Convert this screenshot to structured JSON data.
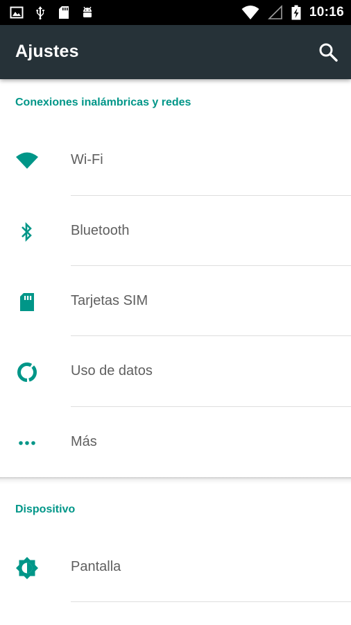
{
  "status_bar": {
    "time": "10:16",
    "left_icons": [
      "image-icon",
      "usb-icon",
      "sd-card-icon",
      "android-icon"
    ],
    "right_icons": [
      "wifi-signal-icon",
      "cell-signal-icon",
      "battery-icon"
    ]
  },
  "app_bar": {
    "title": "Ajustes",
    "action_icon": "search-icon"
  },
  "sections": [
    {
      "header": "Conexiones inalámbricas y redes",
      "items": [
        {
          "label": "Wi-Fi",
          "icon": "wifi-icon"
        },
        {
          "label": "Bluetooth",
          "icon": "bluetooth-icon"
        },
        {
          "label": "Tarjetas SIM",
          "icon": "sim-card-icon"
        },
        {
          "label": "Uso de datos",
          "icon": "data-usage-icon"
        },
        {
          "label": "Más",
          "icon": "more-dots-icon"
        }
      ]
    },
    {
      "header": "Dispositivo",
      "items": [
        {
          "label": "Pantalla",
          "icon": "brightness-icon"
        }
      ]
    }
  ],
  "colors": {
    "accent": "#009688",
    "app_bar": "#263238",
    "status_bar": "#000000",
    "label_text": "#5f5f5f"
  }
}
